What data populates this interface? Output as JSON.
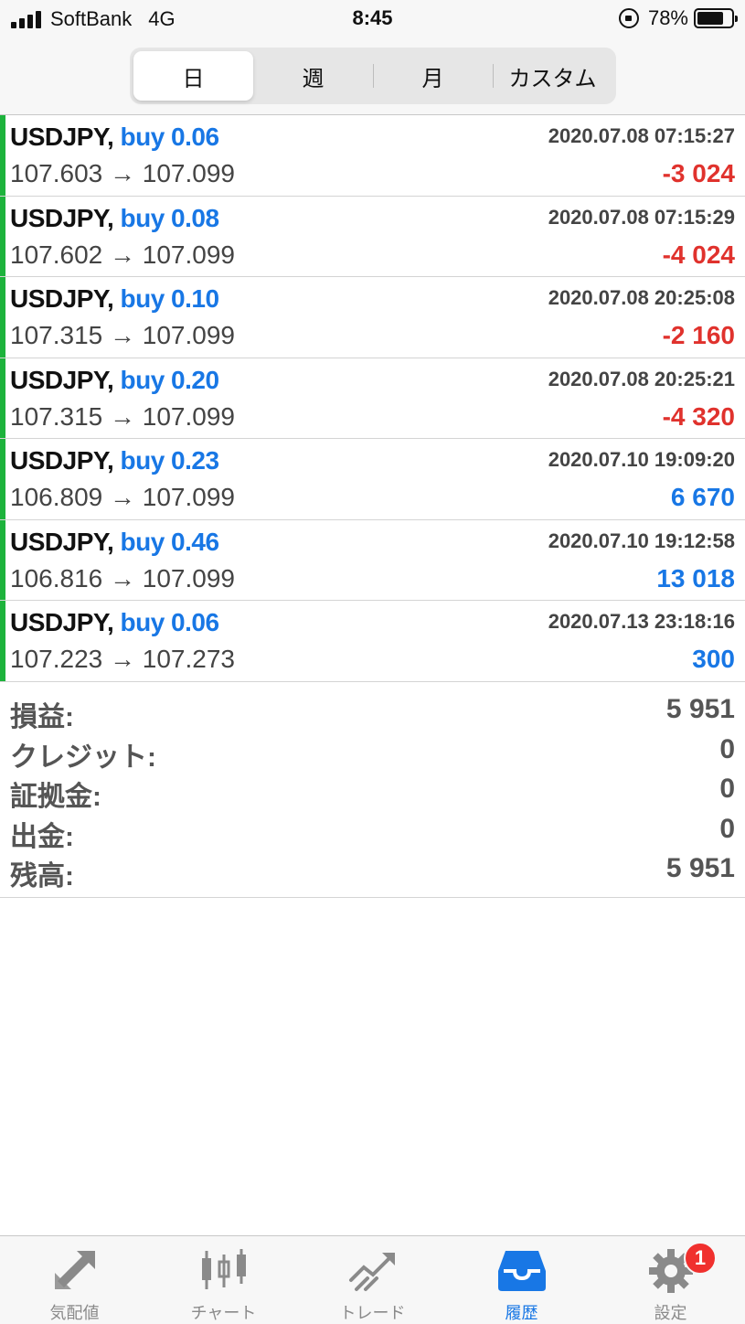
{
  "status_bar": {
    "carrier": "SoftBank",
    "network": "4G",
    "time": "8:45",
    "battery": "78%",
    "battery_level": 0.78
  },
  "periods": {
    "day": "日",
    "week": "週",
    "month": "月",
    "custom": "カスタム",
    "selected": "日"
  },
  "trades": [
    {
      "symbol": "USDJPY,",
      "side": "buy 0.06",
      "time": "2020.07.08 07:15:27",
      "open": "107.603",
      "arrow": "→",
      "close": "107.099",
      "profit": "-3 024",
      "sign": "neg"
    },
    {
      "symbol": "USDJPY,",
      "side": "buy 0.08",
      "time": "2020.07.08 07:15:29",
      "open": "107.602",
      "arrow": "→",
      "close": "107.099",
      "profit": "-4 024",
      "sign": "neg"
    },
    {
      "symbol": "USDJPY,",
      "side": "buy 0.10",
      "time": "2020.07.08 20:25:08",
      "open": "107.315",
      "arrow": "→",
      "close": "107.099",
      "profit": "-2 160",
      "sign": "neg"
    },
    {
      "symbol": "USDJPY,",
      "side": "buy 0.20",
      "time": "2020.07.08 20:25:21",
      "open": "107.315",
      "arrow": "→",
      "close": "107.099",
      "profit": "-4 320",
      "sign": "neg"
    },
    {
      "symbol": "USDJPY,",
      "side": "buy 0.23",
      "time": "2020.07.10 19:09:20",
      "open": "106.809",
      "arrow": "→",
      "close": "107.099",
      "profit": "6 670",
      "sign": "pos"
    },
    {
      "symbol": "USDJPY,",
      "side": "buy 0.46",
      "time": "2020.07.10 19:12:58",
      "open": "106.816",
      "arrow": "→",
      "close": "107.099",
      "profit": "13 018",
      "sign": "pos"
    },
    {
      "symbol": "USDJPY,",
      "side": "buy 0.06",
      "time": "2020.07.13 23:18:16",
      "open": "107.223",
      "arrow": "→",
      "close": "107.273",
      "profit": "300",
      "sign": "pos"
    }
  ],
  "summary": {
    "profit": {
      "label": "損益:",
      "value": "5 951"
    },
    "credit": {
      "label": "クレジット:",
      "value": "0"
    },
    "deposit": {
      "label": "証拠金:",
      "value": "0"
    },
    "withdrawal": {
      "label": "出金:",
      "value": "0"
    },
    "balance": {
      "label": "残高:",
      "value": "5 951"
    }
  },
  "tabs": [
    {
      "label": "気配値",
      "icon": "quotes-arrows-icon"
    },
    {
      "label": "チャート",
      "icon": "candlestick-chart-icon"
    },
    {
      "label": "トレード",
      "icon": "trade-trend-icon"
    },
    {
      "label": "履歴",
      "icon": "history-inbox-icon",
      "active": true
    },
    {
      "label": "設定",
      "icon": "settings-gear-icon",
      "badge": "1"
    }
  ],
  "colors": {
    "buy": "#1877e5",
    "loss": "#e0322d",
    "profit": "#1877e5",
    "row_marker": "#1db33c",
    "active_tab": "#1877e5",
    "inactive_tab": "#8a8a8a",
    "badge": "#f0302e"
  }
}
